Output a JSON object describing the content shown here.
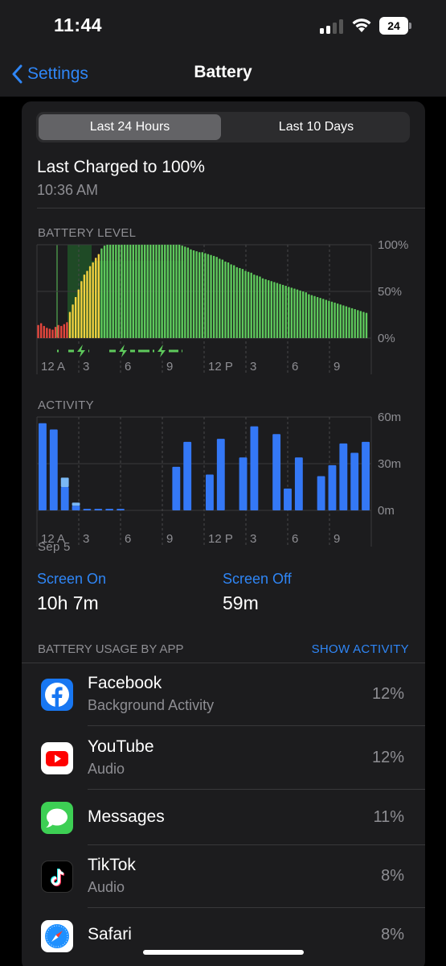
{
  "status_bar": {
    "time": "11:44",
    "battery_level": "24"
  },
  "nav": {
    "back_label": "Settings",
    "title": "Battery"
  },
  "segmented": {
    "options": [
      "Last 24 Hours",
      "Last 10 Days"
    ],
    "selected": "Last 24 Hours"
  },
  "last_charged": {
    "title": "Last Charged to 100%",
    "time": "10:36 AM"
  },
  "battery_level_section": {
    "label": "BATTERY LEVEL"
  },
  "activity_section": {
    "label": "ACTIVITY",
    "date_label": "Sep 5"
  },
  "screen_on": {
    "label": "Screen On",
    "value": "10h 7m"
  },
  "screen_off": {
    "label": "Screen Off",
    "value": "59m"
  },
  "usage_by_app": {
    "label": "BATTERY USAGE BY APP",
    "show_activity_label": "SHOW ACTIVITY",
    "apps": [
      {
        "name": "Facebook",
        "subtitle": "Background Activity",
        "percent": "12%",
        "icon": "facebook-icon"
      },
      {
        "name": "YouTube",
        "subtitle": "Audio",
        "percent": "12%",
        "icon": "youtube-icon"
      },
      {
        "name": "Messages",
        "subtitle": "",
        "percent": "11%",
        "icon": "messages-icon"
      },
      {
        "name": "TikTok",
        "subtitle": "Audio",
        "percent": "8%",
        "icon": "tiktok-icon"
      },
      {
        "name": "Safari",
        "subtitle": "",
        "percent": "8%",
        "icon": "safari-icon"
      }
    ]
  },
  "colors": {
    "accent_blue": "#2f86f6",
    "battery_green": "#5ec95c",
    "battery_yellow": "#f2d13f",
    "battery_red": "#e5463d",
    "activity_blue": "#3478f6",
    "activity_light_blue": "#7ab8f5",
    "charging_region": "#1f4a26"
  },
  "chart_data": [
    {
      "type": "bar",
      "name": "battery-level",
      "x_ticks": [
        "12 A",
        "3",
        "6",
        "9",
        "12 P",
        "3",
        "6",
        "9"
      ],
      "y_ticks": [
        "100%",
        "50%",
        "0%"
      ],
      "ylim": [
        0,
        100
      ],
      "unit": "%",
      "values": [
        14,
        16,
        13,
        11,
        10,
        9,
        12,
        14,
        13,
        15,
        17,
        28,
        36,
        44,
        52,
        61,
        68,
        72,
        77,
        81,
        86,
        90,
        96,
        99,
        100,
        100,
        100,
        100,
        100,
        100,
        100,
        100,
        100,
        100,
        100,
        100,
        100,
        100,
        100,
        100,
        100,
        100,
        100,
        100,
        100,
        100,
        100,
        100,
        100,
        100,
        99,
        98,
        97,
        95,
        94,
        93,
        92,
        92,
        91,
        90,
        89,
        88,
        87,
        85,
        84,
        82,
        81,
        79,
        78,
        76,
        75,
        74,
        72,
        71,
        70,
        68,
        67,
        66,
        64,
        63,
        62,
        61,
        60,
        59,
        58,
        57,
        56,
        55,
        54,
        53,
        52,
        51,
        50,
        49,
        47,
        46,
        45,
        44,
        43,
        42,
        41,
        40,
        39,
        38,
        37,
        36,
        35,
        34,
        33,
        32,
        31,
        30,
        29,
        28,
        27
      ],
      "charging_values": [
        14,
        16,
        13,
        11,
        10,
        9,
        12,
        14,
        13,
        15,
        17
      ],
      "low_power_indexes_end": 11,
      "yellow_indexes_end": 22
    },
    {
      "type": "bar",
      "name": "activity",
      "x_ticks": [
        "12 A",
        "3",
        "6",
        "9",
        "12 P",
        "3",
        "6",
        "9"
      ],
      "y_ticks": [
        "60m",
        "30m",
        "0m"
      ],
      "ylim": [
        0,
        60
      ],
      "unit": "minutes",
      "screen_on": [
        56,
        52,
        15,
        3,
        1,
        1,
        1,
        1,
        0,
        0,
        0,
        0,
        28,
        44,
        0,
        23,
        46,
        0,
        34,
        54,
        0,
        49,
        14,
        34,
        0,
        22,
        29,
        43,
        37,
        44
      ],
      "screen_off": [
        0,
        0,
        6,
        2,
        0,
        0,
        0,
        0,
        0,
        0,
        0,
        0,
        0,
        0,
        0,
        0,
        0,
        0,
        0,
        0,
        0,
        0,
        0,
        0,
        0,
        0,
        0,
        0,
        0,
        0
      ]
    }
  ]
}
